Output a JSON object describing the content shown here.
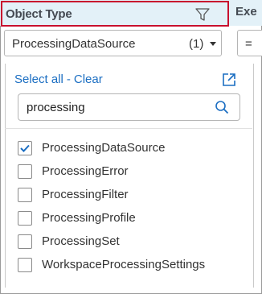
{
  "header": {
    "column_title": "Object Type",
    "next_column_title": "Exe"
  },
  "select": {
    "value": "ProcessingDataSource",
    "count": "(1)"
  },
  "operator": {
    "label": "="
  },
  "links": {
    "select_all": "Select all",
    "separator": "-",
    "clear": "Clear"
  },
  "search": {
    "value": "processing"
  },
  "options": [
    {
      "label": "ProcessingDataSource",
      "checked": true
    },
    {
      "label": "ProcessingError",
      "checked": false
    },
    {
      "label": "ProcessingFilter",
      "checked": false
    },
    {
      "label": "ProcessingProfile",
      "checked": false
    },
    {
      "label": "ProcessingSet",
      "checked": false
    },
    {
      "label": "WorkspaceProcessingSettings",
      "checked": false
    }
  ],
  "colors": {
    "header_bg": "#e3f1f8",
    "highlight_border": "#c8102e",
    "link": "#1b6ec2",
    "check": "#1b6ec2"
  },
  "icons": [
    "filter-icon",
    "popout-icon",
    "search-icon",
    "checkmark-icon",
    "chevron-down-icon"
  ]
}
